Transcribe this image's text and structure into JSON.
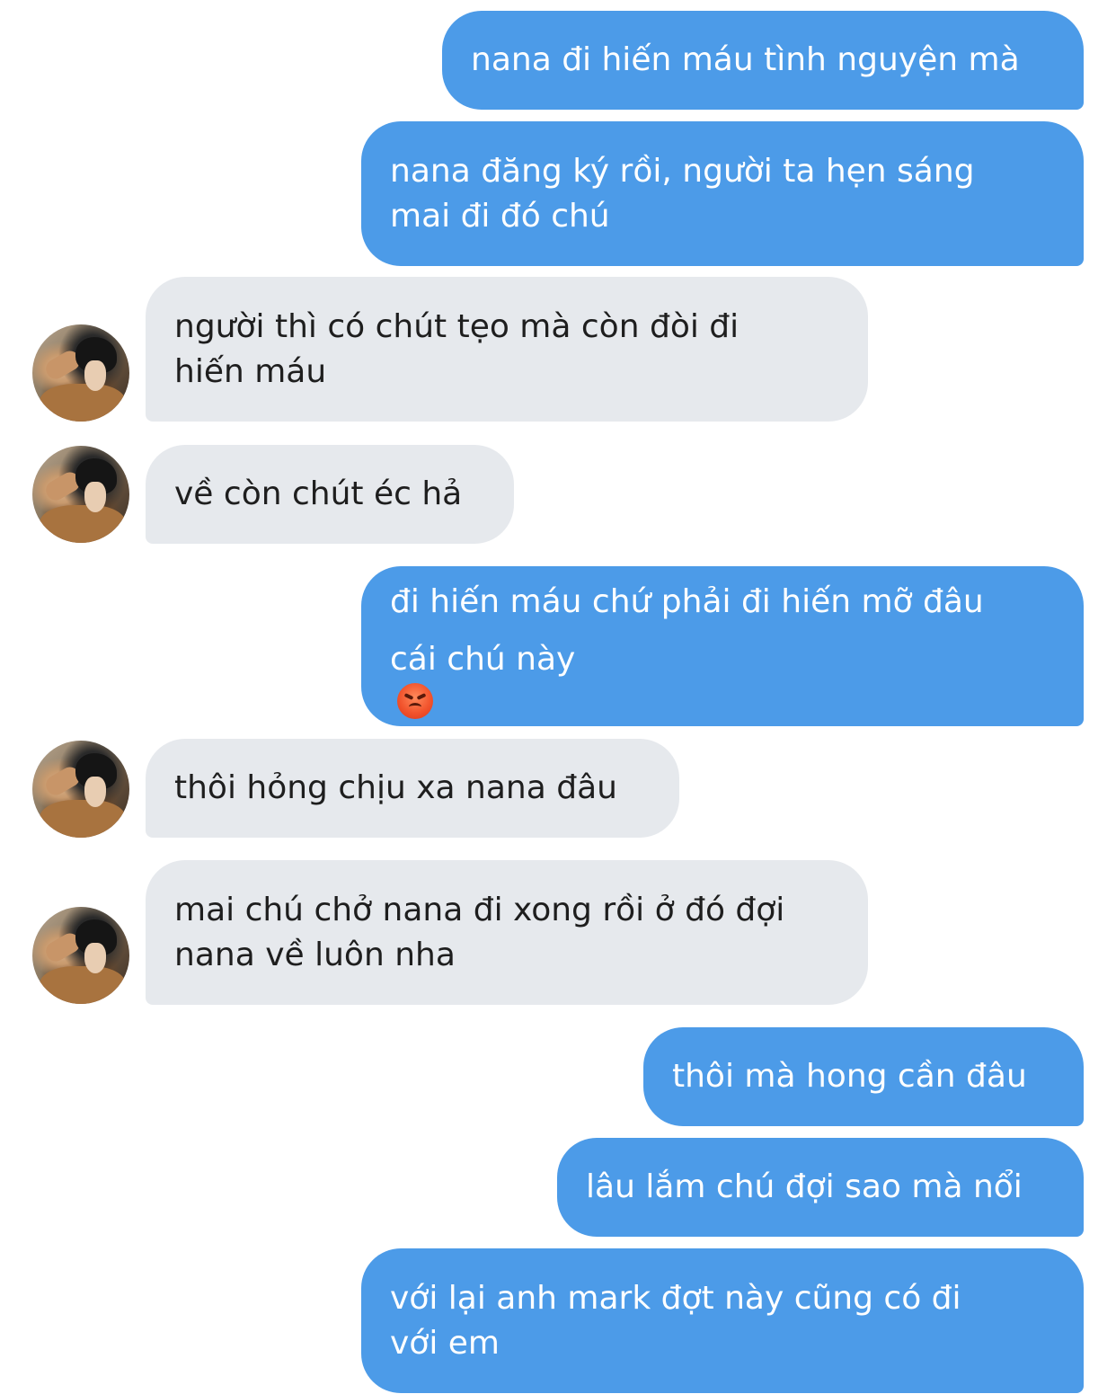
{
  "conversation": {
    "messages": [
      {
        "sender": "me",
        "lines": [
          "nana đi hiến máu tình nguyện mà"
        ]
      },
      {
        "sender": "me",
        "lines": [
          "nana đăng ký rồi, người ta hẹn sáng",
          "mai đi đó chú"
        ]
      },
      {
        "sender": "other",
        "lines": [
          "người thì có chút tẹo mà còn đòi đi",
          "hiến máu"
        ]
      },
      {
        "sender": "other",
        "lines": [
          "về còn chút éc hả"
        ]
      },
      {
        "sender": "me",
        "lines": [
          "đi hiến máu chứ phải đi hiến mỡ đâu",
          "cái chú này"
        ],
        "emoji": "pouting-face"
      },
      {
        "sender": "other",
        "lines": [
          "thôi hỏng chịu xa nana đâu"
        ]
      },
      {
        "sender": "other",
        "lines": [
          "mai chú chở nana đi xong rồi ở đó đợi",
          "nana về luôn nha"
        ]
      },
      {
        "sender": "me",
        "lines": [
          "thôi mà hong cần đâu"
        ]
      },
      {
        "sender": "me",
        "lines": [
          "lâu lắm chú đợi sao mà nổi"
        ]
      },
      {
        "sender": "me",
        "lines": [
          "với lại anh mark đợt này cũng có đi",
          "với em"
        ]
      }
    ]
  },
  "colors": {
    "outgoing_bubble": "#4c9be8",
    "incoming_bubble": "#e6e9ed",
    "outgoing_text": "#ffffff",
    "incoming_text": "#1e1e1e"
  }
}
